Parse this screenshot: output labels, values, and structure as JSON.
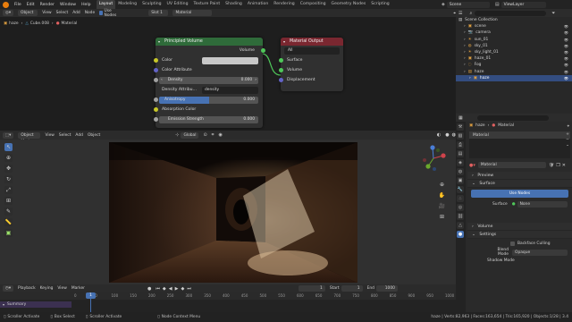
{
  "topbar": {
    "menus": [
      "File",
      "Edit",
      "Render",
      "Window",
      "Help"
    ],
    "workspaces": [
      "Layout",
      "Modeling",
      "Sculpting",
      "UV Editing",
      "Texture Paint",
      "Shading",
      "Animation",
      "Rendering",
      "Compositing",
      "Geometry Nodes",
      "Scripting"
    ],
    "active_workspace": "Layout",
    "scene": "Scene",
    "view_layer": "ViewLayer"
  },
  "node_editor": {
    "header": {
      "editor_type": "Object",
      "menus": [
        "View",
        "Select",
        "Add",
        "Node"
      ],
      "use_nodes_label": "Use Nodes",
      "slot": "Slot 1",
      "material": "Material"
    },
    "breadcrumb": [
      "haze",
      "Cube.008",
      "Material"
    ],
    "principled": {
      "title": "Principled Volume",
      "output": "Volume",
      "rows": [
        {
          "label": "Color"
        },
        {
          "label": "Color Attribute"
        },
        {
          "label": "Density",
          "value": "0.000"
        },
        {
          "label": "Density Attribu...",
          "value": "density"
        },
        {
          "label": "Anisotropy",
          "value": "0.000"
        },
        {
          "label": "Absorption Color"
        },
        {
          "label": "Emission Strength",
          "value": "0.000"
        }
      ]
    },
    "output": {
      "title": "Material Output",
      "target": "All",
      "inputs": [
        "Surface",
        "Volume",
        "Displacement"
      ]
    }
  },
  "viewport": {
    "header": {
      "mode": "Object Mode",
      "menus": [
        "View",
        "Select",
        "Add",
        "Object"
      ],
      "orientation": "Global"
    }
  },
  "timeline": {
    "menus": [
      "Playback",
      "Keying",
      "View",
      "Marker"
    ],
    "current_frame": "1",
    "start_label": "Start",
    "start": "1",
    "end_label": "End",
    "end": "1000",
    "ticks": [
      "0",
      "50",
      "100",
      "150",
      "200",
      "250",
      "300",
      "350",
      "400",
      "450",
      "500",
      "550",
      "600",
      "650",
      "700",
      "750",
      "800",
      "850",
      "900",
      "950",
      "1000"
    ],
    "track_label": "Summary"
  },
  "outliner": {
    "title": "Scene Collection",
    "items": [
      {
        "name": "scene",
        "indent": 1
      },
      {
        "name": "camera",
        "indent": 1
      },
      {
        "name": "sun_01",
        "indent": 1
      },
      {
        "name": "sky_01",
        "indent": 1
      },
      {
        "name": "sky_light_01",
        "indent": 1
      },
      {
        "name": "haze_01",
        "indent": 1
      },
      {
        "name": "Fog",
        "indent": 1
      },
      {
        "name": "haze",
        "indent": 1
      },
      {
        "name": "haze",
        "indent": 2,
        "selected": true
      }
    ]
  },
  "properties": {
    "breadcrumb": [
      "haze",
      "Material"
    ],
    "slot_name": "Material",
    "material_field": "Material",
    "sections": {
      "preview": "Preview",
      "surface": "Surface",
      "volume": "Volume",
      "settings": "Settings"
    },
    "use_nodes": "Use Nodes",
    "surface_label": "Surface",
    "surface_value": "None",
    "backface_culling": "Backface Culling",
    "blend_mode_label": "Blend Mode",
    "blend_mode": "Opaque",
    "shadow_mode_label": "Shadow Mode"
  },
  "status": {
    "left": [
      "Scroller Activate",
      "Box Select",
      "Scroller Activate",
      "Node Context Menu"
    ],
    "right": "haze | Verts:82,963 | Faces:163,654 | Tris:165,920 | Objects:1/28 | 3.4"
  },
  "colors": {
    "principled_header": "#2f6b3a",
    "output_header": "#7a2730",
    "selection": "#334d80",
    "accent": "#4772b3"
  }
}
